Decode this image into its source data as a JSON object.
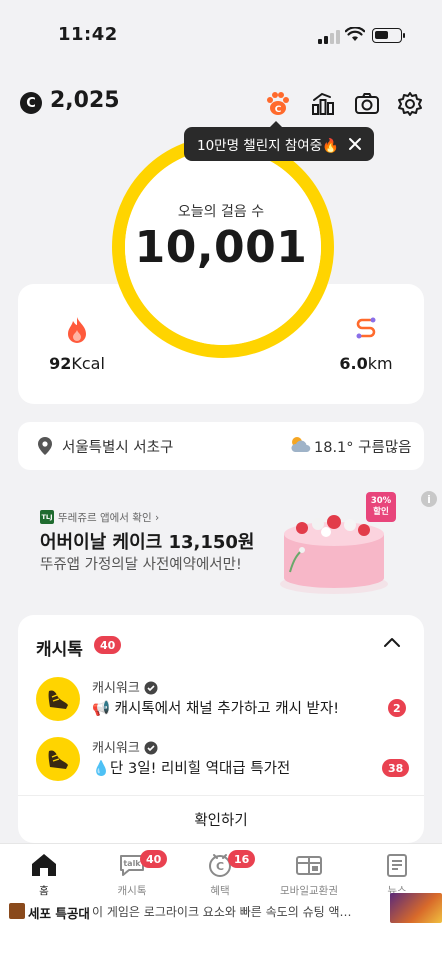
{
  "status_bar": {
    "time": "11:42"
  },
  "header": {
    "coin_symbol": "C",
    "coin_amount": "2,025",
    "icons": [
      "paw-icon",
      "chart-icon",
      "camera-icon",
      "settings-icon"
    ]
  },
  "tooltip": {
    "text": "10만명 챌린지 참여중🔥"
  },
  "steps": {
    "label": "오늘의 걸음 수",
    "count": "10,001"
  },
  "stats": {
    "calories": {
      "value": "92",
      "unit": "Kcal"
    },
    "distance": {
      "value": "6.0",
      "unit": "km"
    }
  },
  "location": {
    "place": "서울특별시 서초구",
    "weather": "18.1° 구름많음"
  },
  "ad": {
    "source": "뚜레쥬르 앱에서 확인 ›",
    "logo_text": "TLJ",
    "title": "어버이날 케이크 13,150원",
    "subtitle": "뚜쥬앱 가정의달 사전예약에서만!",
    "badge_line1": "30%",
    "badge_line2": "할인",
    "info": "i"
  },
  "cashtalk": {
    "title": "캐시톡",
    "count": "40",
    "messages": [
      {
        "sender": "캐시워크",
        "text": "📢 캐시톡에서 채널 추가하고 캐시 받자!",
        "count": "2"
      },
      {
        "sender": "캐시워크",
        "text": "💧단 3일! 리비힐 역대급 특가전",
        "count": "38"
      }
    ],
    "confirm_label": "확인하기"
  },
  "tabbar": {
    "tabs": [
      {
        "label": "홈",
        "badge": ""
      },
      {
        "label": "캐시톡",
        "badge": "40"
      },
      {
        "label": "혜택",
        "badge": "16"
      },
      {
        "label": "모바일교환권",
        "badge": ""
      },
      {
        "label": "뉴스",
        "badge": ""
      }
    ]
  },
  "ticker": {
    "title": "세포 특공대",
    "text": "이 게임은 로그라이크 요소와 빠른 속도의 슈팅 액션이..."
  },
  "colors": {
    "ring": "#ffd400",
    "badge": "#e94150",
    "accent_orange": "#ff6a2c"
  }
}
